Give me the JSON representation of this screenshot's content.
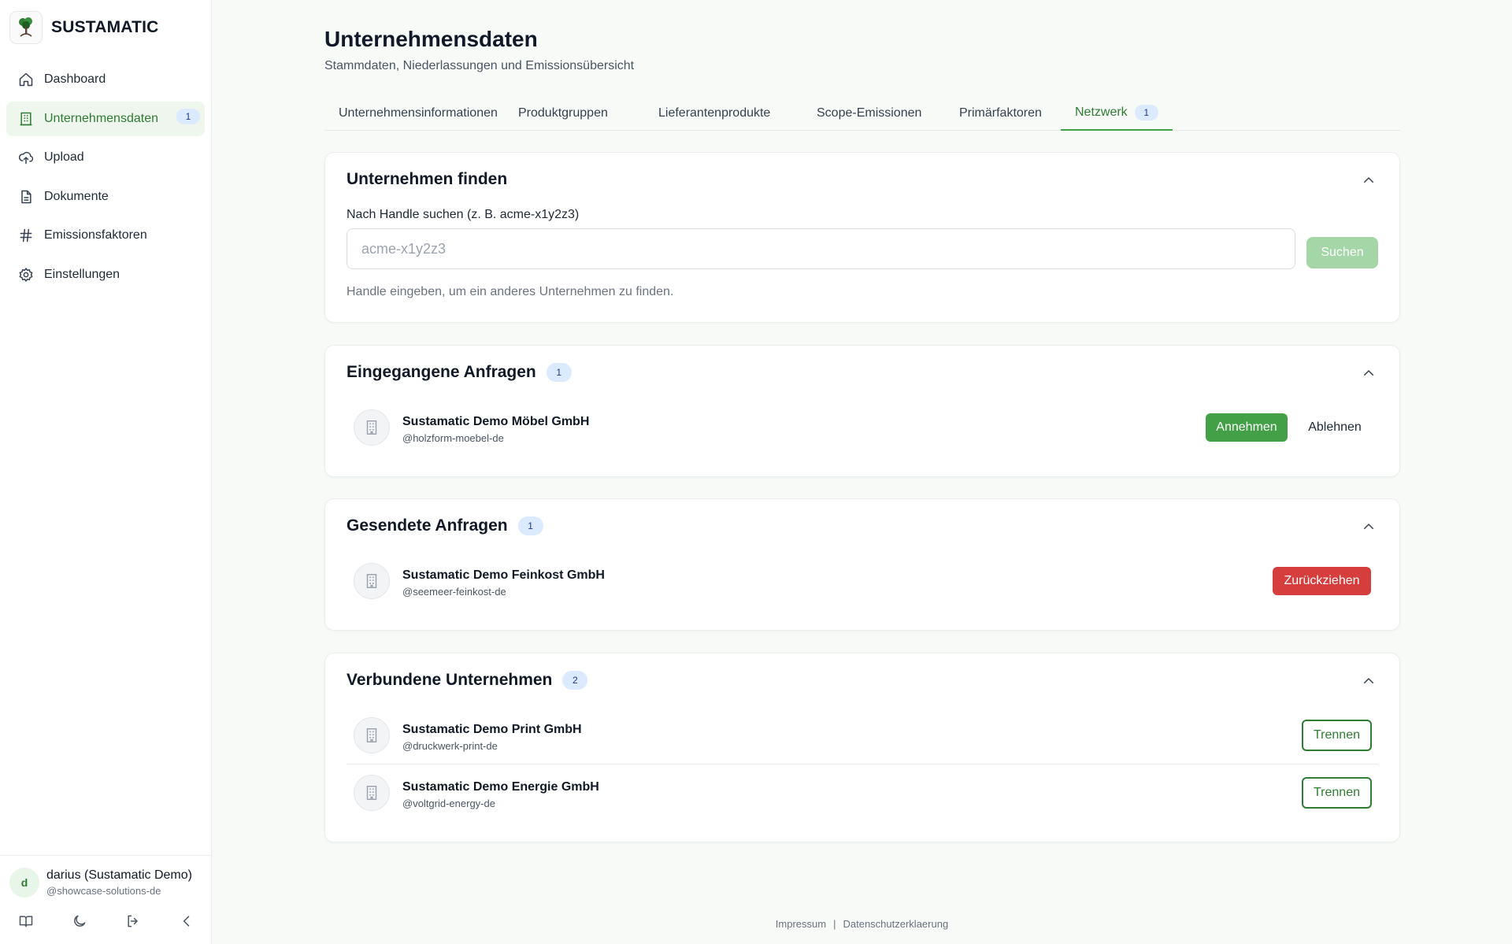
{
  "brand": {
    "name": "SUSTAMATIC"
  },
  "sidebar": {
    "items": [
      {
        "label": "Dashboard",
        "icon": "home-icon"
      },
      {
        "label": "Unternehmensdaten",
        "icon": "building-icon",
        "badge": "1"
      },
      {
        "label": "Upload",
        "icon": "cloud-upload-icon"
      },
      {
        "label": "Dokumente",
        "icon": "document-icon"
      },
      {
        "label": "Emissionsfaktoren",
        "icon": "hash-icon"
      },
      {
        "label": "Einstellungen",
        "icon": "gear-icon"
      }
    ],
    "user": {
      "initial": "d",
      "name": "darius (Sustamatic Demo)",
      "handle": "@showcase-solutions-de"
    }
  },
  "page": {
    "title": "Unternehmensdaten",
    "subtitle": "Stammdaten, Niederlassungen und Emissionsübersicht"
  },
  "tabs": [
    {
      "label": "Unternehmensinformationen"
    },
    {
      "label": "Produktgruppen"
    },
    {
      "label": "Lieferantenprodukte"
    },
    {
      "label": "Scope-Emissionen"
    },
    {
      "label": "Primärfaktoren"
    },
    {
      "label": "Netzwerk",
      "badge": "1",
      "active": true
    }
  ],
  "find": {
    "title": "Unternehmen finden",
    "label": "Nach Handle suchen (z. B. acme-x1y2z3)",
    "placeholder": "acme-x1y2z3",
    "button": "Suchen",
    "hint": "Handle eingeben, um ein anderes Unternehmen zu finden."
  },
  "incoming": {
    "title": "Eingegangene Anfragen",
    "count": "1",
    "items": [
      {
        "name": "Sustamatic Demo Möbel GmbH",
        "handle": "@holzform-moebel-de",
        "accept": "Annehmen",
        "decline": "Ablehnen"
      }
    ]
  },
  "sent": {
    "title": "Gesendete Anfragen",
    "count": "1",
    "items": [
      {
        "name": "Sustamatic Demo Feinkost GmbH",
        "handle": "@seemeer-feinkost-de",
        "withdraw": "Zurückziehen"
      }
    ]
  },
  "connected": {
    "title": "Verbundene Unternehmen",
    "count": "2",
    "items": [
      {
        "name": "Sustamatic Demo Print GmbH",
        "handle": "@druckwerk-print-de",
        "disconnect": "Trennen"
      },
      {
        "name": "Sustamatic Demo Energie GmbH",
        "handle": "@voltgrid-energy-de",
        "disconnect": "Trennen"
      }
    ]
  },
  "legal": {
    "impressum": "Impressum",
    "separator": "|",
    "privacy": "Datenschutzerklaerung"
  },
  "colors": {
    "accent": "#2e7d32",
    "accept": "#43a047",
    "danger": "#d63d3d",
    "badge": "#dbeafe"
  }
}
